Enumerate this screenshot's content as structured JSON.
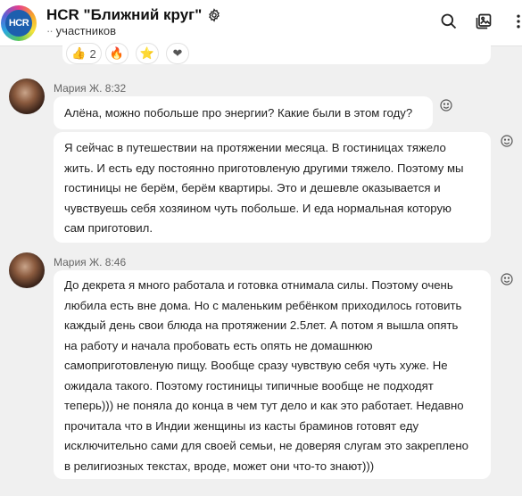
{
  "header": {
    "logo_text": "HCR",
    "title": "HCR \"Ближний круг\"",
    "subtitle_prefix": "··",
    "subtitle": "участников"
  },
  "reactions": [
    {
      "icon": "thumbs-up",
      "count": "2"
    },
    {
      "icon": "fire",
      "count": ""
    },
    {
      "icon": "star",
      "count": ""
    },
    {
      "icon": "heart",
      "count": ""
    }
  ],
  "messages": [
    {
      "author": "Мария Ж.",
      "time": "8:32",
      "text": "Алёна, можно побольше про энергии? Какие были в этом году?"
    },
    {
      "author": "",
      "time": "",
      "lines": [
        "Я сейчас в путешествии на протяжении месяца. В гостиницах тяжело",
        "жить. И есть еду постоянно приготовленую другими тяжело. Поэтому мы",
        "гостиницы не берём, берём квартиры. Это и дешевле оказывается и",
        "чувствуешь себя хозяином чуть побольше. И еда нормальная которую",
        "сам приготовил."
      ]
    },
    {
      "author": "Мария Ж.",
      "time": "8:46",
      "lines": [
        "До декрета я много работала и готовка отнимала силы. Поэтому очень",
        "любила есть вне дома. Но с маленьким ребёнком приходилось готовить",
        "каждый день свои блюда на протяжении 2.5лет. А потом я вышла опять",
        "на работу и начала пробовать есть опять не домашнюю",
        "самоприготовленую пищу. Вообще сразу чувствую себя чуть хуже. Не",
        "ожидала такого. Поэтому гостиницы типичные вообще не подходят",
        "теперь))) не поняла до конца в чем тут дело и как это работает. Недавно",
        "прочитала что в Индии женщины из касты браминов готовят еду",
        "исключительно сами для своей семьи, не доверяя слугам это закреплено",
        "в религиозных текстах, вроде, может они что-то знают)))"
      ]
    }
  ]
}
